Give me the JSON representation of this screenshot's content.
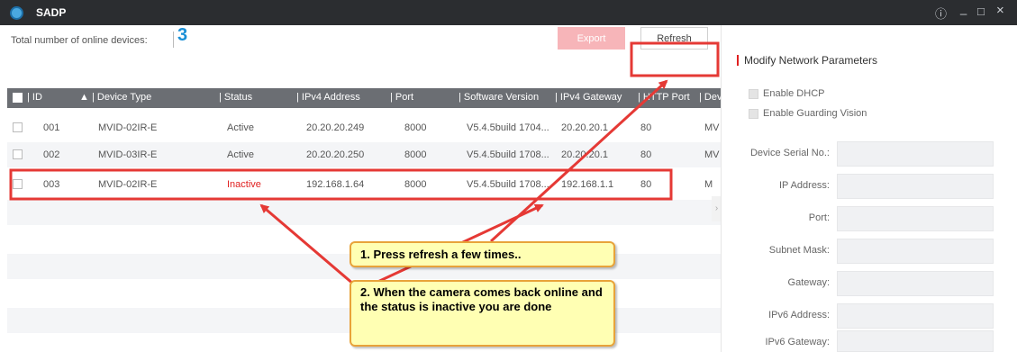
{
  "app": {
    "title": "SADP"
  },
  "window_controls": {
    "info": "ⓘ",
    "minimize": "_",
    "maximize": "□",
    "close": "×"
  },
  "toolbar": {
    "total_label": "Total number of online devices:",
    "total_count": "3",
    "export_label": "Export",
    "refresh_label": "Refresh"
  },
  "table": {
    "columns": [
      "ID",
      "Device Type",
      "Status",
      "IPv4 Address",
      "Port",
      "Software Version",
      "IPv4 Gateway",
      "HTTP Port",
      "Dev"
    ],
    "sort_indicator": "▲",
    "rows": [
      {
        "id": "001",
        "device_type": "MVID-02IR-E",
        "status": "Active",
        "ipv4": "20.20.20.249",
        "port": "8000",
        "software": "V5.4.5build 1704...",
        "gateway": "20.20.20.1",
        "http_port": "80",
        "dev": "MV"
      },
      {
        "id": "002",
        "device_type": "MVID-03IR-E",
        "status": "Active",
        "ipv4": "20.20.20.250",
        "port": "8000",
        "software": "V5.4.5build 1708...",
        "gateway": "20.20.20.1",
        "http_port": "80",
        "dev": "MV"
      },
      {
        "id": "003",
        "device_type": "MVID-02IR-E",
        "status": "Inactive",
        "ipv4": "192.168.1.64",
        "port": "8000",
        "software": "V5.4.5build 1708...",
        "gateway": "192.168.1.1",
        "http_port": "80",
        "dev": "M"
      }
    ]
  },
  "panel": {
    "title": "Modify Network Parameters",
    "enable_dhcp": "Enable DHCP",
    "enable_guarding": "Enable Guarding Vision",
    "fields": [
      "Device Serial No.:",
      "IP Address:",
      "Port:",
      "Subnet Mask:",
      "Gateway:",
      "IPv6 Address:",
      "IPv6 Gateway:"
    ]
  },
  "annotations": {
    "callout1": "1. Press refresh a few times..",
    "callout2": "2. When the camera comes back online and the status is inactive you are done",
    "highlight_color": "#e53935"
  },
  "colors": {
    "titlebar": "#2b2d30",
    "accent_blue": "#1a8fd6",
    "export_button": "#f7b5b9",
    "inactive_status": "#e02020",
    "header_bg": "#6b6e73"
  }
}
